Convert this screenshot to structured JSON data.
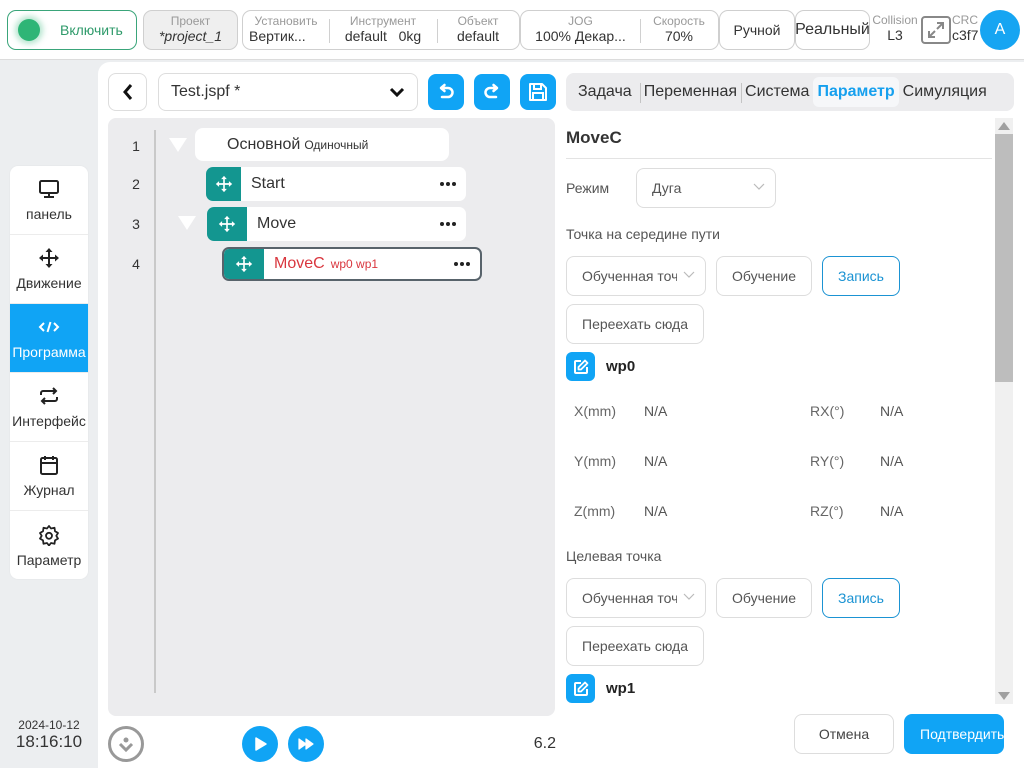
{
  "topbar": {
    "enable_label": "Включить",
    "project": {
      "caption": "Проект",
      "value": "*project_1"
    },
    "install": {
      "caption": "Установить",
      "value": "Вертик..."
    },
    "tool": {
      "caption": "Инструмент",
      "value": "default",
      "weight": "0kg"
    },
    "object": {
      "caption": "Объект",
      "value": "default"
    },
    "jog": {
      "caption": "JOG",
      "value": "100%  Декар..."
    },
    "speed": {
      "caption": "Скорость",
      "value": "70%"
    },
    "mode": "Ручной",
    "env": "Реальный",
    "collision": {
      "caption": "Collision",
      "value": "L3"
    },
    "crc": {
      "caption": "CRC",
      "value": "c3f7"
    },
    "avatar": "A"
  },
  "sidebar": {
    "items": [
      {
        "label": "панель",
        "icon": "monitor-icon",
        "active": false
      },
      {
        "label": "Движение",
        "icon": "move-arrows-icon",
        "active": false
      },
      {
        "label": "Программа",
        "icon": "code-icon",
        "active": true
      },
      {
        "label": "Интерфейс",
        "icon": "swap-icon",
        "active": false
      },
      {
        "label": "Журнал",
        "icon": "calendar-icon",
        "active": false
      },
      {
        "label": "Параметр",
        "icon": "gear-icon",
        "active": false
      }
    ]
  },
  "datetime": {
    "date": "2024-10-12",
    "time": "18:16:10"
  },
  "editor": {
    "file_name": "Test.jspf *",
    "tree": [
      {
        "line": "1",
        "label": "Основной",
        "sub": "Одиночный"
      },
      {
        "line": "2",
        "label": "Start"
      },
      {
        "line": "3",
        "label": "Move"
      },
      {
        "line": "4",
        "label": "MoveC",
        "params": "wp0 wp1",
        "selected": true
      }
    ],
    "version": "6.2"
  },
  "tabs": [
    {
      "label": "Задача",
      "active": false
    },
    {
      "label": "Переменная",
      "active": false
    },
    {
      "label": "Система",
      "active": false
    },
    {
      "label": "Параметр",
      "active": true
    },
    {
      "label": "Симуляция",
      "active": false
    }
  ],
  "params": {
    "title": "MoveC",
    "mode_label": "Режим",
    "mode_value": "Дуга",
    "mid_label": "Точка на середине пути",
    "target_label": "Целевая точка",
    "point_select": "Обученная точ",
    "teach_btn": "Обучение",
    "record_btn": "Запись",
    "move_here_btn": "Переехать сюда",
    "wp0": {
      "name": "wp0",
      "coords": [
        {
          "label": "X(mm)",
          "value": "N/A"
        },
        {
          "label": "RX(°)",
          "value": "N/A"
        },
        {
          "label": "Y(mm)",
          "value": "N/A"
        },
        {
          "label": "RY(°)",
          "value": "N/A"
        },
        {
          "label": "Z(mm)",
          "value": "N/A"
        },
        {
          "label": "RZ(°)",
          "value": "N/A"
        }
      ]
    },
    "wp1": {
      "name": "wp1"
    }
  },
  "footer": {
    "cancel": "Отмена",
    "confirm": "Подтвердить"
  },
  "colors": {
    "accent": "#10a4f5",
    "teal": "#139690",
    "enable": "#2eb576",
    "error": "#d9363e"
  }
}
